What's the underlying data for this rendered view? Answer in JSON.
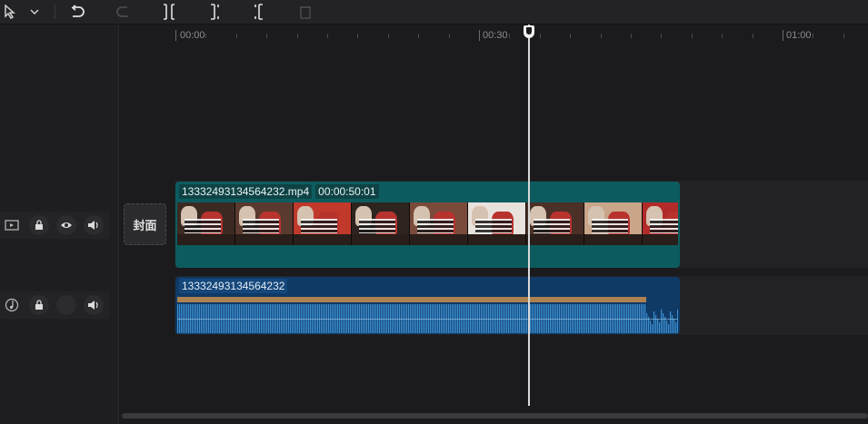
{
  "toolbar": {
    "icons": [
      "cursor-icon",
      "dropdown-chevron-icon",
      "undo-icon",
      "redo-icon",
      "split-icon",
      "split-left-icon",
      "split-right-icon",
      "delete-icon"
    ]
  },
  "ruler": {
    "labels": [
      "00:00",
      "00:30",
      "01:00"
    ]
  },
  "tracks": {
    "video": {
      "controls": [
        "video-track-icon",
        "lock-icon",
        "eye-icon",
        "volume-icon"
      ],
      "cover_label": "封面",
      "clip_name": "13332493134564232.mp4",
      "clip_duration": "00:00:50:01"
    },
    "audio": {
      "controls": [
        "audio-track-icon",
        "lock-icon",
        "volume-icon"
      ],
      "clip_name": "13332493134564232"
    }
  },
  "colors": {
    "video_clip": "#0c5c5f",
    "audio_clip": "#0f3a66",
    "playhead": "#d9d9d9"
  }
}
